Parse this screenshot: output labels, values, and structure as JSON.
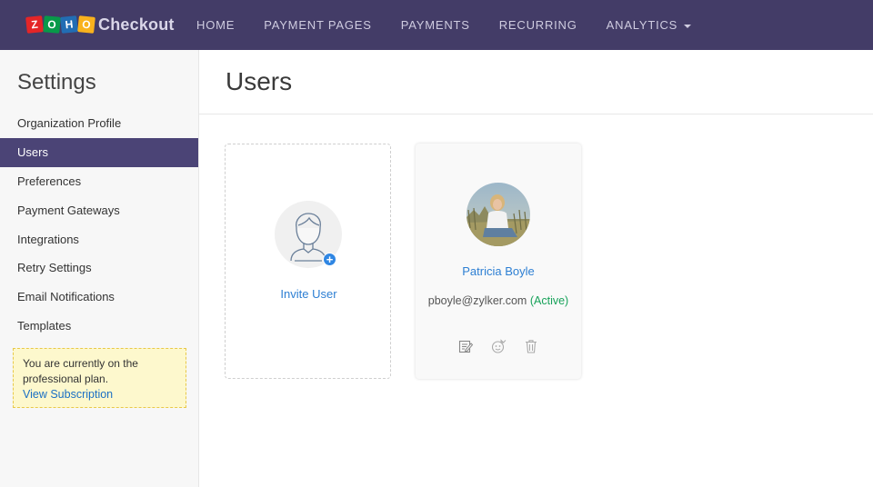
{
  "app": {
    "logo_letters": [
      "Z",
      "O",
      "H",
      "O"
    ],
    "product_name": "Checkout"
  },
  "nav": {
    "items": [
      {
        "label": "HOME"
      },
      {
        "label": "PAYMENT PAGES"
      },
      {
        "label": "PAYMENTS"
      },
      {
        "label": "RECURRING"
      },
      {
        "label": "ANALYTICS"
      }
    ]
  },
  "sidebar": {
    "title": "Settings",
    "items": [
      {
        "label": "Organization Profile",
        "active": false
      },
      {
        "label": "Users",
        "active": true
      },
      {
        "label": "Preferences",
        "active": false
      },
      {
        "label": "Payment Gateways",
        "active": false
      },
      {
        "label": "Integrations",
        "active": false
      },
      {
        "label": "Retry Settings",
        "active": false
      },
      {
        "label": "Email Notifications",
        "active": false
      },
      {
        "label": "Templates",
        "active": false
      }
    ],
    "plan_notice": "You are currently on the professional plan.",
    "plan_link": "View Subscription"
  },
  "main": {
    "title": "Users",
    "invite": {
      "label": "Invite User",
      "icon": "user-plus-icon"
    },
    "users": [
      {
        "name": "Patricia Boyle",
        "email": "pboyle@zylker.com",
        "status": "(Active)",
        "actions": [
          "edit-icon",
          "impersonate-icon",
          "trash-icon"
        ]
      }
    ]
  },
  "colors": {
    "nav_bg": "#433c67",
    "active_item": "#4b4476",
    "link": "#2d7fd3",
    "status_active": "#18a25a",
    "plan_bg": "#fdf8cd"
  }
}
